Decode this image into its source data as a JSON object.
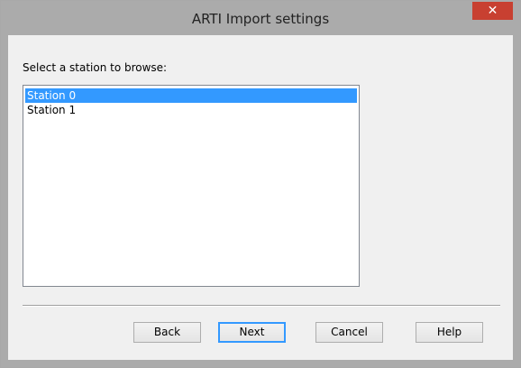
{
  "window": {
    "title": "ARTI Import settings",
    "close_glyph": "✕"
  },
  "main": {
    "prompt": "Select a station to browse:",
    "stations": [
      "Station 0",
      "Station 1"
    ],
    "selected_station": "Station 0"
  },
  "buttons": {
    "back": "Back",
    "next": "Next",
    "cancel": "Cancel",
    "help": "Help"
  },
  "colors": {
    "title_bar": "#ababab",
    "close_button": "#c84031",
    "selection": "#3399ff"
  }
}
